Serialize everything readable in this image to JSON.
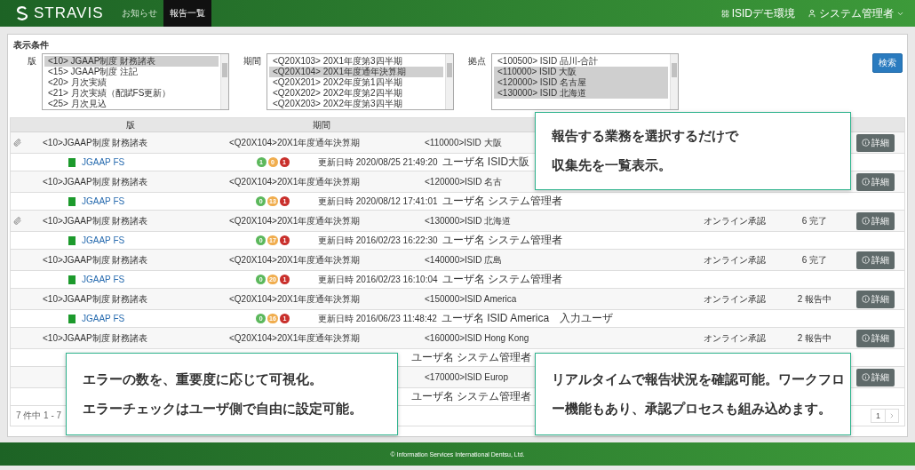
{
  "header": {
    "logo": "STRAVIS",
    "nav": [
      {
        "label": "お知らせ",
        "selected": false
      },
      {
        "label": "報告一覧",
        "selected": true
      }
    ],
    "environment": "ISIDデモ環境",
    "user": "システム管理者"
  },
  "filters": {
    "title": "表示条件",
    "lists": [
      {
        "label": "版",
        "items": [
          {
            "text": "<10> JGAAP制度 財務諸表",
            "selected": true
          },
          {
            "text": "<15> JGAAP制度 注記",
            "selected": false
          },
          {
            "text": "<20> 月次実績",
            "selected": false
          },
          {
            "text": "<21> 月次実績（配賦FS更新）",
            "selected": false
          },
          {
            "text": "<25> 月次見込",
            "selected": false
          }
        ]
      },
      {
        "label": "期間",
        "items": [
          {
            "text": "<Q20X103> 20X1年度第3四半期",
            "selected": false
          },
          {
            "text": "<Q20X104> 20X1年度通年決算期",
            "selected": true
          },
          {
            "text": "<Q20X201> 20X2年度第1四半期",
            "selected": false
          },
          {
            "text": "<Q20X202> 20X2年度第2四半期",
            "selected": false
          },
          {
            "text": "<Q20X203> 20X2年度第3四半期",
            "selected": false
          }
        ]
      },
      {
        "label": "拠点",
        "items": [
          {
            "text": "<100500> ISID 品川-合計",
            "selected": false
          },
          {
            "text": "<110000> ISID 大阪",
            "selected": true
          },
          {
            "text": "<120000> ISID 名古屋",
            "selected": true
          },
          {
            "text": "<130000> ISID 北海道",
            "selected": true
          }
        ]
      }
    ],
    "search_button": "検索"
  },
  "table": {
    "columns": [
      "版",
      "期間"
    ],
    "records": [
      {
        "attachment": true,
        "version": "<10>JGAAP制度 財務諸表",
        "period": "<Q20X104>20X1年度通年決算期",
        "place": "<110000>ISID 大阪",
        "button": "詳細",
        "report": {
          "name": "JGAAP FS",
          "errors": [
            {
              "count": "1",
              "color": "#5cb85c"
            },
            {
              "count": "0",
              "color": "#f0ad4e"
            },
            {
              "count": "1",
              "color": "#c9302c"
            }
          ],
          "updated": "更新日時 2020/08/25 21:49:20",
          "user": "ユーザ名 ISID大阪"
        }
      },
      {
        "attachment": false,
        "version": "<10>JGAAP制度 財務諸表",
        "period": "<Q20X104>20X1年度通年決算期",
        "place": "<120000>ISID 名古",
        "button": "詳細",
        "report": {
          "name": "JGAAP FS",
          "errors": [
            {
              "count": "0",
              "color": "#5cb85c"
            },
            {
              "count": "13",
              "color": "#f0ad4e"
            },
            {
              "count": "1",
              "color": "#c9302c"
            }
          ],
          "updated": "更新日時 2020/08/12 17:41:01",
          "user": "ユーザ名 システム管理者"
        }
      },
      {
        "attachment": true,
        "version": "<10>JGAAP制度 財務諸表",
        "period": "<Q20X104>20X1年度通年決算期",
        "place": "<130000>ISID 北海道",
        "approval": "オンライン承認",
        "status": "6 完了",
        "button": "詳細",
        "report": {
          "name": "JGAAP FS",
          "errors": [
            {
              "count": "0",
              "color": "#5cb85c"
            },
            {
              "count": "17",
              "color": "#f0ad4e"
            },
            {
              "count": "1",
              "color": "#c9302c"
            }
          ],
          "updated": "更新日時 2016/02/23 16:22:30",
          "user": "ユーザ名 システム管理者"
        }
      },
      {
        "attachment": false,
        "version": "<10>JGAAP制度 財務諸表",
        "period": "<Q20X104>20X1年度通年決算期",
        "place": "<140000>ISID 広島",
        "approval": "オンライン承認",
        "status": "6 完了",
        "button": "詳細",
        "report": {
          "name": "JGAAP FS",
          "errors": [
            {
              "count": "0",
              "color": "#5cb85c"
            },
            {
              "count": "20",
              "color": "#f0ad4e"
            },
            {
              "count": "1",
              "color": "#c9302c"
            }
          ],
          "updated": "更新日時 2016/02/23 16:10:04",
          "user": "ユーザ名 システム管理者"
        }
      },
      {
        "attachment": false,
        "version": "<10>JGAAP制度 財務諸表",
        "period": "<Q20X104>20X1年度通年決算期",
        "place": "<150000>ISID America",
        "approval": "オンライン承認",
        "status": "2 報告中",
        "button": "詳細",
        "report": {
          "name": "JGAAP FS",
          "errors": [
            {
              "count": "0",
              "color": "#5cb85c"
            },
            {
              "count": "16",
              "color": "#f0ad4e"
            },
            {
              "count": "1",
              "color": "#c9302c"
            }
          ],
          "updated": "更新日時 2016/06/23 11:48:42",
          "user": "ユーザ名 ISID America　入力ユーザ"
        }
      },
      {
        "attachment": false,
        "version": "<10>JGAAP制度 財務諸表",
        "period": "<Q20X104>20X1年度通年決算期",
        "place": "<160000>ISID Hong Kong",
        "approval": "オンライン承認",
        "status": "2 報告中",
        "button": "詳細",
        "report": {
          "user": "ユーザ名 システム管理者"
        }
      },
      {
        "attachment": false,
        "place": "<170000>ISID Europ",
        "button": "詳細",
        "report": {
          "user": "ユーザ名 システム管理者"
        }
      }
    ],
    "summary": "7 件中 1 - 7",
    "pages": [
      "1"
    ]
  },
  "callouts": [
    {
      "lines": [
        "報告する業務を選択するだけで",
        "収集先を一覧表示。"
      ]
    },
    {
      "lines": [
        "エラーの数を、重要度に応じて可視化。",
        "エラーチェックはユーザ側で自由に設定可能。"
      ]
    },
    {
      "lines": [
        "リアルタイムで報告状況を確認可能。ワークフロ",
        "ー機能もあり、承認プロセスも組み込めます。"
      ]
    }
  ],
  "footer": "© Information Services International Dentsu, Ltd."
}
